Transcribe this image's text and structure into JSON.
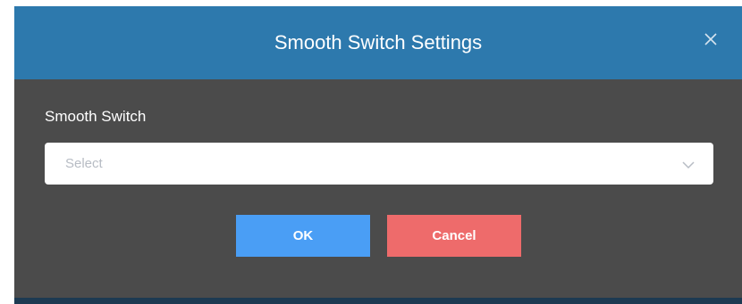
{
  "dialog": {
    "title": "Smooth Switch Settings",
    "close_icon": "close-icon"
  },
  "form": {
    "field_label": "Smooth Switch",
    "select_placeholder": "Select",
    "select_icon": "chevron-down-icon"
  },
  "actions": {
    "ok_label": "OK",
    "cancel_label": "Cancel"
  },
  "colors": {
    "header": "#2d79ad",
    "body": "#4b4b4b",
    "ok": "#4a9ef5",
    "cancel": "#ee6b6b"
  }
}
